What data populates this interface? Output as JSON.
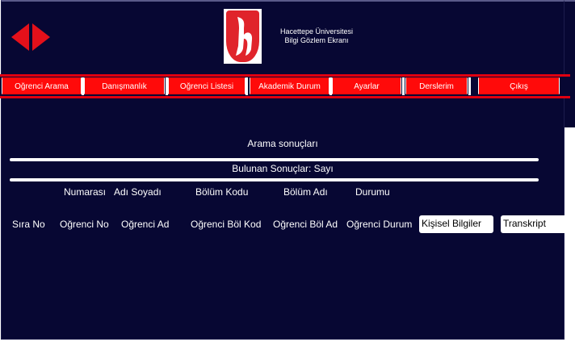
{
  "header": {
    "institution_line1": "Hacettepe Üniversitesi",
    "institution_line2": "Bilgi Gözlem Ekranı"
  },
  "icons": {
    "prev": "arrow-left-icon",
    "next": "arrow-right-icon",
    "logo": "hacettepe-logo"
  },
  "colors": {
    "background": "#070733",
    "accent": "#ff0a0a"
  },
  "nav": {
    "items": [
      {
        "label": "Oğrenci Arama"
      },
      {
        "label": "Danışmanlık"
      },
      {
        "label": "Oğrenci Listesi"
      },
      {
        "label": "Akademik Durum"
      },
      {
        "label": "Ayarlar"
      },
      {
        "label": "Derslerim"
      },
      {
        "label": "Çıkış"
      }
    ]
  },
  "results": {
    "title": "Arama sonuçları",
    "found_label": "Bulunan Sonuçlar: Sayı",
    "columns": [
      "Numarası",
      "Adı Soyadı",
      "Bölüm Kodu",
      "Bölüm Adı",
      "Durumu"
    ],
    "row": {
      "index": "Sıra No",
      "number": "Oğrenci No",
      "name": "Oğrenci Ad",
      "dept_code": "Oğrenci Böl Kod",
      "dept_name": "Oğrenci Böl Ad",
      "status": "Oğrenci Durum",
      "personal_button": "Kişisel Bilgiler",
      "transcript_button": "Transkript"
    }
  }
}
